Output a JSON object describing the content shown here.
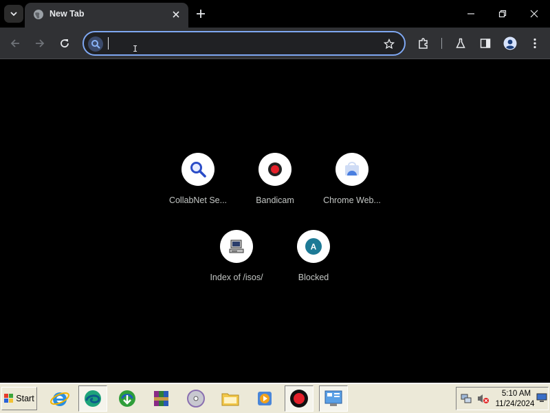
{
  "browser": {
    "tab": {
      "title": "New Tab"
    },
    "omnibox": {
      "value": "",
      "placeholder": ""
    }
  },
  "ntp": {
    "shortcuts": [
      {
        "label": "CollabNet Se...",
        "icon": "magnifier-icon"
      },
      {
        "label": "Bandicam",
        "icon": "record-icon"
      },
      {
        "label": "Chrome Web...",
        "icon": "chrome-web-store-icon"
      },
      {
        "label": "Index of /isos/",
        "icon": "computer-icon"
      },
      {
        "label": "Blocked",
        "icon": "letter-avatar-icon",
        "letter": "A"
      }
    ]
  },
  "taskbar": {
    "start_label": "Start",
    "apps": [
      "internet-explorer-icon",
      "edge-icon",
      "download-manager-icon",
      "winrar-icon",
      "dvd-icon",
      "folder-icon",
      "media-player-icon",
      "bandicam-icon",
      "control-panel-icon"
    ],
    "clock": {
      "time": "5:10 AM",
      "date": "11/24/2024"
    }
  },
  "colors": {
    "tab_bg": "#303134",
    "omnibox_border": "#7fa8f3",
    "page_bg": "#000000",
    "taskbar_bg": "#ece9d8"
  }
}
